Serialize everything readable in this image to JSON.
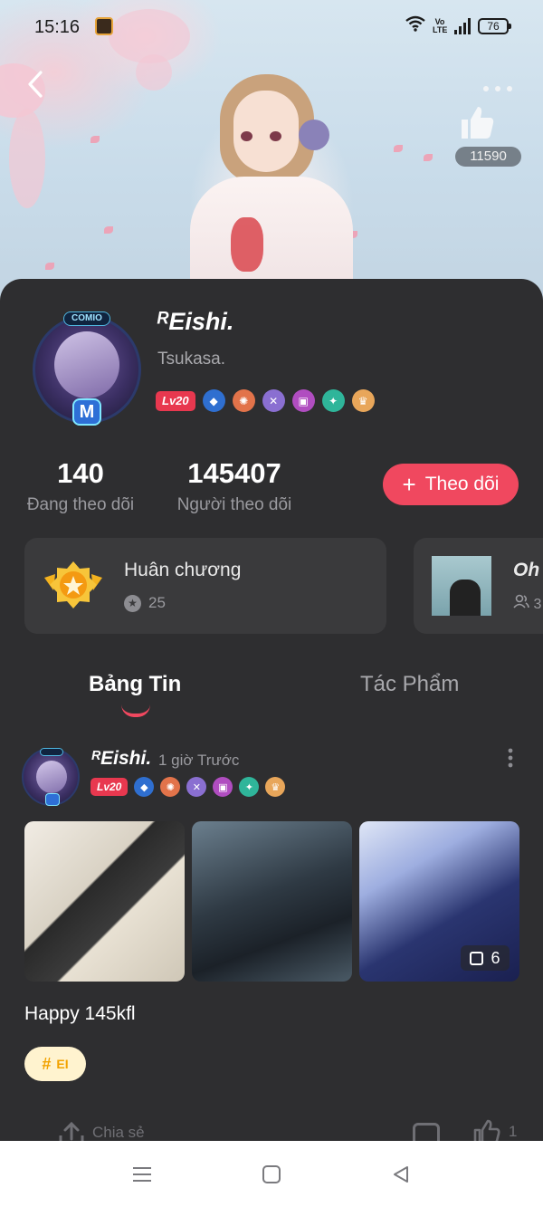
{
  "status_bar": {
    "time": "15:16",
    "volte": "Vo LTE",
    "battery": "76"
  },
  "header": {
    "like_count": "11590"
  },
  "profile": {
    "avatar_top_tag": "COMIO",
    "avatar_badge": "M",
    "username": "ᴿEishi.",
    "subname": "Tsukasa.",
    "level": "Lv20",
    "following_count": "140",
    "following_label": "Đang theo dõi",
    "followers_count": "145407",
    "followers_label": "Người theo dõi",
    "follow_button": "Theo dõi"
  },
  "cards": {
    "medal": {
      "title": "Huân chương",
      "count": "25"
    },
    "group": {
      "title": "Oh",
      "count": "3"
    }
  },
  "tabs": [
    {
      "label": "Bảng Tin",
      "active": true
    },
    {
      "label": "Tác Phẩm",
      "active": false
    }
  ],
  "post": {
    "author": "ᴿEishi.",
    "time": "1 giờ Trước",
    "level": "Lv20",
    "image_count": "6",
    "text": "Happy 145kfl",
    "tag": "EI",
    "share_label": "Chia sẻ",
    "like_count": "1"
  },
  "colors": {
    "accent": "#f0485f",
    "panel": "#2e2e30",
    "card": "#3a3a3c",
    "tag_bg": "#fff3cf",
    "tag_text": "#f2a200"
  }
}
